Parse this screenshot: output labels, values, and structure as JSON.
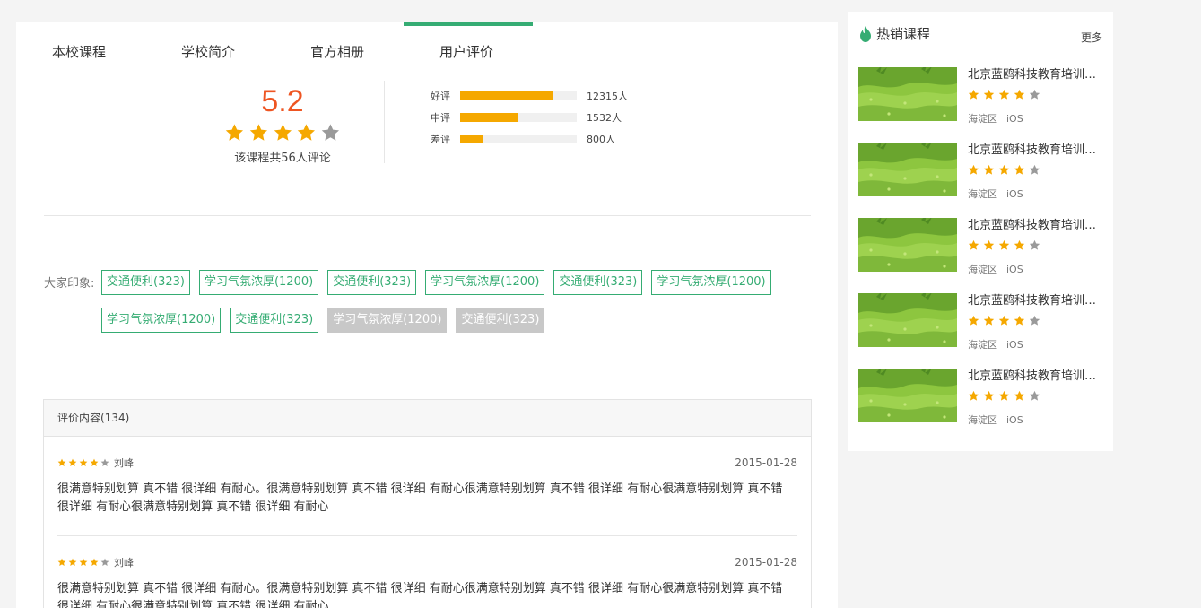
{
  "tabs": [
    {
      "label": "本校课程"
    },
    {
      "label": "学校简介"
    },
    {
      "label": "官方相册"
    },
    {
      "label": "用户评价"
    }
  ],
  "summary": {
    "score": "5.2",
    "stars_filled": 4,
    "stars_total": 5,
    "count_text": "该课程共56人评论"
  },
  "ratings": [
    {
      "label": "好评",
      "count": "12315人",
      "fraction": 0.8
    },
    {
      "label": "中评",
      "count": "1532人",
      "fraction": 0.5
    },
    {
      "label": "差评",
      "count": "800人",
      "fraction": 0.2
    }
  ],
  "impressions": {
    "label": "大家印象:",
    "tags": [
      {
        "text": "交通便利(323)",
        "style": "green"
      },
      {
        "text": "学习气氛浓厚(1200)",
        "style": "green"
      },
      {
        "text": "交通便利(323)",
        "style": "green"
      },
      {
        "text": "学习气氛浓厚(1200)",
        "style": "green"
      },
      {
        "text": "交通便利(323)",
        "style": "green"
      },
      {
        "text": "学习气氛浓厚(1200)",
        "style": "green"
      },
      {
        "text": "学习气氛浓厚(1200)",
        "style": "green"
      },
      {
        "text": "交通便利(323)",
        "style": "green"
      },
      {
        "text": "学习气氛浓厚(1200)",
        "style": "grey"
      },
      {
        "text": "交通便利(323)",
        "style": "grey"
      }
    ]
  },
  "reviews": {
    "header": "评价内容(134)",
    "items": [
      {
        "stars": 4,
        "author": "刘峰",
        "date": "2015-01-28",
        "text": "很满意特别划算 真不错 很详细 有耐心。很满意特别划算 真不错 很详细 有耐心很满意特别划算 真不错 很详细 有耐心很满意特别划算 真不错 很详细 有耐心很满意特别划算 真不错 很详细 有耐心"
      },
      {
        "stars": 4,
        "author": "刘峰",
        "date": "2015-01-28",
        "text": "很满意特别划算 真不错 很详细 有耐心。很满意特别划算 真不错 很详细 有耐心很满意特别划算 真不错 很详细 有耐心很满意特别划算 真不错 很详细 有耐心很满意特别划算 真不错 很详细 有耐心"
      }
    ]
  },
  "sidebar": {
    "title": "热销课程",
    "title_icon": "flame-icon",
    "more": "更多",
    "courses": [
      {
        "title": "北京蓝鸥科技教育培训中心",
        "stars": 4,
        "district": "海淀区",
        "tag": "iOS"
      },
      {
        "title": "北京蓝鸥科技教育培训中心",
        "stars": 4,
        "district": "海淀区",
        "tag": "iOS"
      },
      {
        "title": "北京蓝鸥科技教育培训中心",
        "stars": 4,
        "district": "海淀区",
        "tag": "iOS"
      },
      {
        "title": "北京蓝鸥科技教育培训中心",
        "stars": 4,
        "district": "海淀区",
        "tag": "iOS"
      },
      {
        "title": "北京蓝鸥科技教育培训中心",
        "stars": 4,
        "district": "海淀区",
        "tag": "iOS"
      }
    ]
  },
  "colors": {
    "accent_green": "#35ac73",
    "score_orange": "#ee5522",
    "star_gold": "#f5a800",
    "star_grey": "#9a9a9a"
  }
}
